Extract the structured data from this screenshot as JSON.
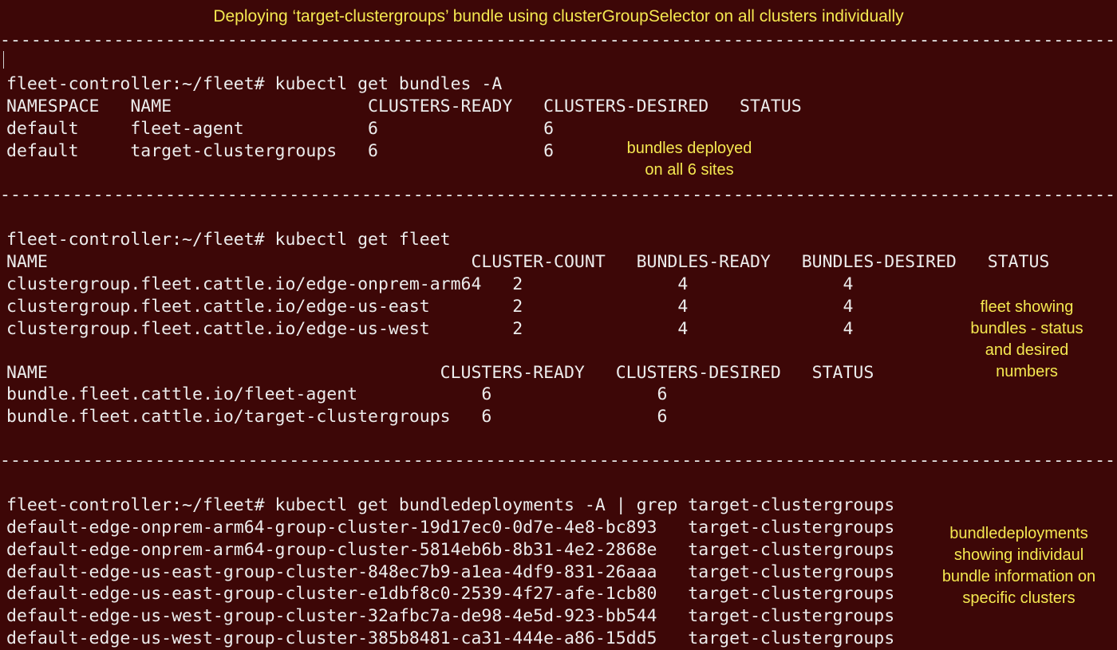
{
  "colors": {
    "background": "#3d0707",
    "terminal_text": "#ececec",
    "annotation": "#f5e850"
  },
  "title": "Deploying ‘target-clustergroups’ bundle using clusterGroupSelector on all clusters individually",
  "separator": "------------------------------------------------------------------------------------------------------------------------------------",
  "bundles": {
    "command": "fleet-controller:~/fleet# kubectl get bundles -A",
    "header": "NAMESPACE   NAME                   CLUSTERS-READY   CLUSTERS-DESIRED   STATUS",
    "rows": [
      "default     fleet-agent            6                6",
      "default     target-clustergroups   6                6"
    ],
    "note_lines": [
      "bundles deployed",
      "on all 6 sites"
    ]
  },
  "fleet": {
    "command": "fleet-controller:~/fleet# kubectl get fleet",
    "header": "NAME                                         CLUSTER-COUNT   BUNDLES-READY   BUNDLES-DESIRED   STATUS",
    "rows": [
      "clustergroup.fleet.cattle.io/edge-onprem-arm64   2               4               4",
      "clustergroup.fleet.cattle.io/edge-us-east        2               4               4",
      "clustergroup.fleet.cattle.io/edge-us-west        2               4               4"
    ],
    "bundle_header": "NAME                                      CLUSTERS-READY   CLUSTERS-DESIRED   STATUS",
    "bundle_rows": [
      "bundle.fleet.cattle.io/fleet-agent            6                6",
      "bundle.fleet.cattle.io/target-clustergroups   6                6"
    ],
    "note_lines": [
      "fleet showing",
      "bundles - status",
      "and desired",
      "numbers"
    ]
  },
  "bundledeployments": {
    "command": "fleet-controller:~/fleet# kubectl get bundledeployments -A | grep target-clustergroups",
    "rows": [
      "default-edge-onprem-arm64-group-cluster-19d17ec0-0d7e-4e8-bc893   target-clustergroups",
      "default-edge-onprem-arm64-group-cluster-5814eb6b-8b31-4e2-2868e   target-clustergroups",
      "default-edge-us-east-group-cluster-848ec7b9-a1ea-4df9-831-26aaa   target-clustergroups",
      "default-edge-us-east-group-cluster-e1dbf8c0-2539-4f27-afe-1cb80   target-clustergroups",
      "default-edge-us-west-group-cluster-32afbc7a-de98-4e5d-923-bb544   target-clustergroups",
      "default-edge-us-west-group-cluster-385b8481-ca31-444e-a86-15dd5   target-clustergroups"
    ],
    "note_lines": [
      "bundledeployments",
      "showing individaul",
      "bundle information on",
      "specific clusters"
    ]
  }
}
